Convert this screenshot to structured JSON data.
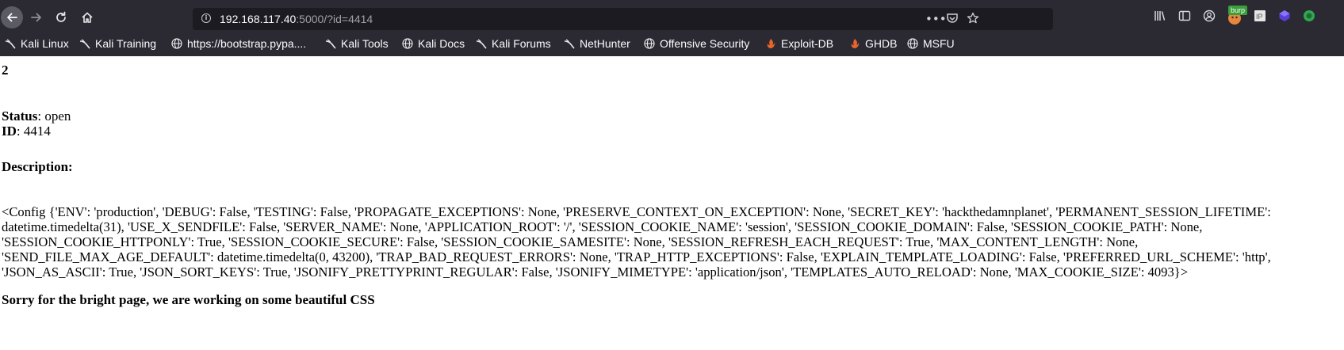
{
  "browser": {
    "url_host": "192.168.117.40",
    "url_rest": ":5000/?id=4414",
    "burp_badge": "burp",
    "icons": {
      "back": "back-arrow-icon",
      "forward": "forward-arrow-icon",
      "reload": "reload-icon",
      "home": "home-icon",
      "info": "info-icon",
      "more": "more-dots-icon",
      "pocket": "pocket-icon",
      "bookmark_star": "star-icon",
      "library": "library-icon",
      "sidebar": "sidebar-icon",
      "account": "account-icon",
      "foxyproxy": "foxyproxy-icon",
      "extension_ip": "ip-extension-icon",
      "extension_purple": "purple-extension-icon",
      "extension_green": "green-extension-icon"
    }
  },
  "bookmarks": [
    {
      "label": "Kali Linux",
      "icon": "kali-dragon-icon"
    },
    {
      "label": "Kali Training",
      "icon": "kali-dragon-icon"
    },
    {
      "label": "https://bootstrap.pypa....",
      "icon": "globe-icon"
    },
    {
      "label": "Kali Tools",
      "icon": "kali-dragon-icon"
    },
    {
      "label": "Kali Docs",
      "icon": "globe-icon"
    },
    {
      "label": "Kali Forums",
      "icon": "kali-dragon-icon"
    },
    {
      "label": "NetHunter",
      "icon": "kali-dragon-icon"
    },
    {
      "label": "Offensive Security",
      "icon": "globe-icon"
    },
    {
      "label": "Exploit-DB",
      "icon": "exploitdb-icon"
    },
    {
      "label": "GHDB",
      "icon": "exploitdb-icon"
    },
    {
      "label": "MSFU",
      "icon": "globe-icon"
    }
  ],
  "page": {
    "number": "2",
    "status_label": "Status",
    "status_value": ": open",
    "id_label": "ID",
    "id_value": ": 4414",
    "description_label": "Description:",
    "config_text": "<Config {'ENV': 'production', 'DEBUG': False, 'TESTING': False, 'PROPAGATE_EXCEPTIONS': None, 'PRESERVE_CONTEXT_ON_EXCEPTION': None, 'SECRET_KEY': 'hackthedamnplanet', 'PERMANENT_SESSION_LIFETIME': datetime.timedelta(31), 'USE_X_SENDFILE': False, 'SERVER_NAME': None, 'APPLICATION_ROOT': '/', 'SESSION_COOKIE_NAME': 'session', 'SESSION_COOKIE_DOMAIN': False, 'SESSION_COOKIE_PATH': None, 'SESSION_COOKIE_HTTPONLY': True, 'SESSION_COOKIE_SECURE': False, 'SESSION_COOKIE_SAMESITE': None, 'SESSION_REFRESH_EACH_REQUEST': True, 'MAX_CONTENT_LENGTH': None, 'SEND_FILE_MAX_AGE_DEFAULT': datetime.timedelta(0, 43200), 'TRAP_BAD_REQUEST_ERRORS': None, 'TRAP_HTTP_EXCEPTIONS': False, 'EXPLAIN_TEMPLATE_LOADING': False, 'PREFERRED_URL_SCHEME': 'http', 'JSON_AS_ASCII': True, 'JSON_SORT_KEYS': True, 'JSONIFY_PRETTYPRINT_REGULAR': False, 'JSONIFY_MIMETYPE': 'application/json', 'TEMPLATES_AUTO_RELOAD': None, 'MAX_COOKIE_SIZE': 4093}>",
    "footer": "Sorry for the bright page, we are working on some beautiful CSS"
  },
  "colors": {
    "chrome_bg": "#2b2a33",
    "urlbar_bg": "#1c1b22",
    "page_bg": "#ffffff"
  }
}
